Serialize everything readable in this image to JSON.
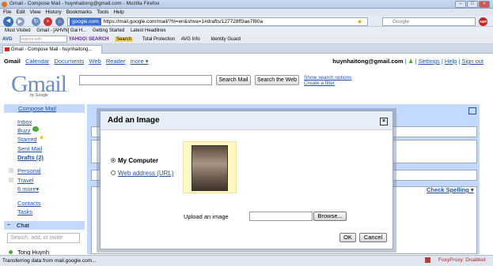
{
  "browser": {
    "title": "Gmail - Compose Mail - huynhaitong@gmail.com - Mozilla Firefox",
    "menu": [
      "File",
      "Edit",
      "View",
      "History",
      "Bookmarks",
      "Tools",
      "Help"
    ],
    "url_site": "google.com",
    "url": "https://mail.google.com/mail/?hl=en&shva=1#drafts/127728ff3ae7f80a",
    "search_placeholder": "Google",
    "bookmarks": [
      "Most Visited",
      "Gmail - [AHVN] Gai H...",
      "Getting Started",
      "Latest Headlines"
    ],
    "toolbar2": [
      "AVG",
      "explore with",
      "YAHOO! SEARCH",
      "Search",
      "Total Protection",
      "AVG Info",
      "Identity Guard"
    ],
    "tab_title": "Gmail - Compose Mail - huynhaitong...",
    "status": "Transferring data from mail.google.com...",
    "foxyproxy": "FoxyProxy: Disabled"
  },
  "gmail": {
    "nav": {
      "brand": "Gmail",
      "links": [
        "Calendar",
        "Documents",
        "Web",
        "Reader",
        "more ▾"
      ]
    },
    "user": {
      "email": "huynhaitong@gmail.com",
      "links": [
        "Settings",
        "Help",
        "Sign out"
      ]
    },
    "logo": "Gmail",
    "logo_sub": "by Google",
    "search_mail": "Search Mail",
    "search_web": "Search the Web",
    "show_options": "Show search options",
    "create_filter": "Create a filter",
    "compose": "Compose Mail",
    "sidebar": [
      "Inbox",
      "Buzz",
      "Starred",
      "Sent Mail",
      "Drafts (2)",
      "Personal",
      "Travel",
      "6 more▾",
      "Contacts",
      "Tasks"
    ],
    "chat": {
      "title": "Chat",
      "search_placeholder": "Search, add, or invite",
      "contact": "Tong Huynh"
    },
    "check_spelling": "Check Spelling ▾"
  },
  "dialog": {
    "title": "Add an Image",
    "option_computer": "My Computer",
    "option_web": "Web address (URL)",
    "upload_label": "Upload an image",
    "browse": "Browse...",
    "ok": "OK",
    "cancel": "Cancel"
  }
}
